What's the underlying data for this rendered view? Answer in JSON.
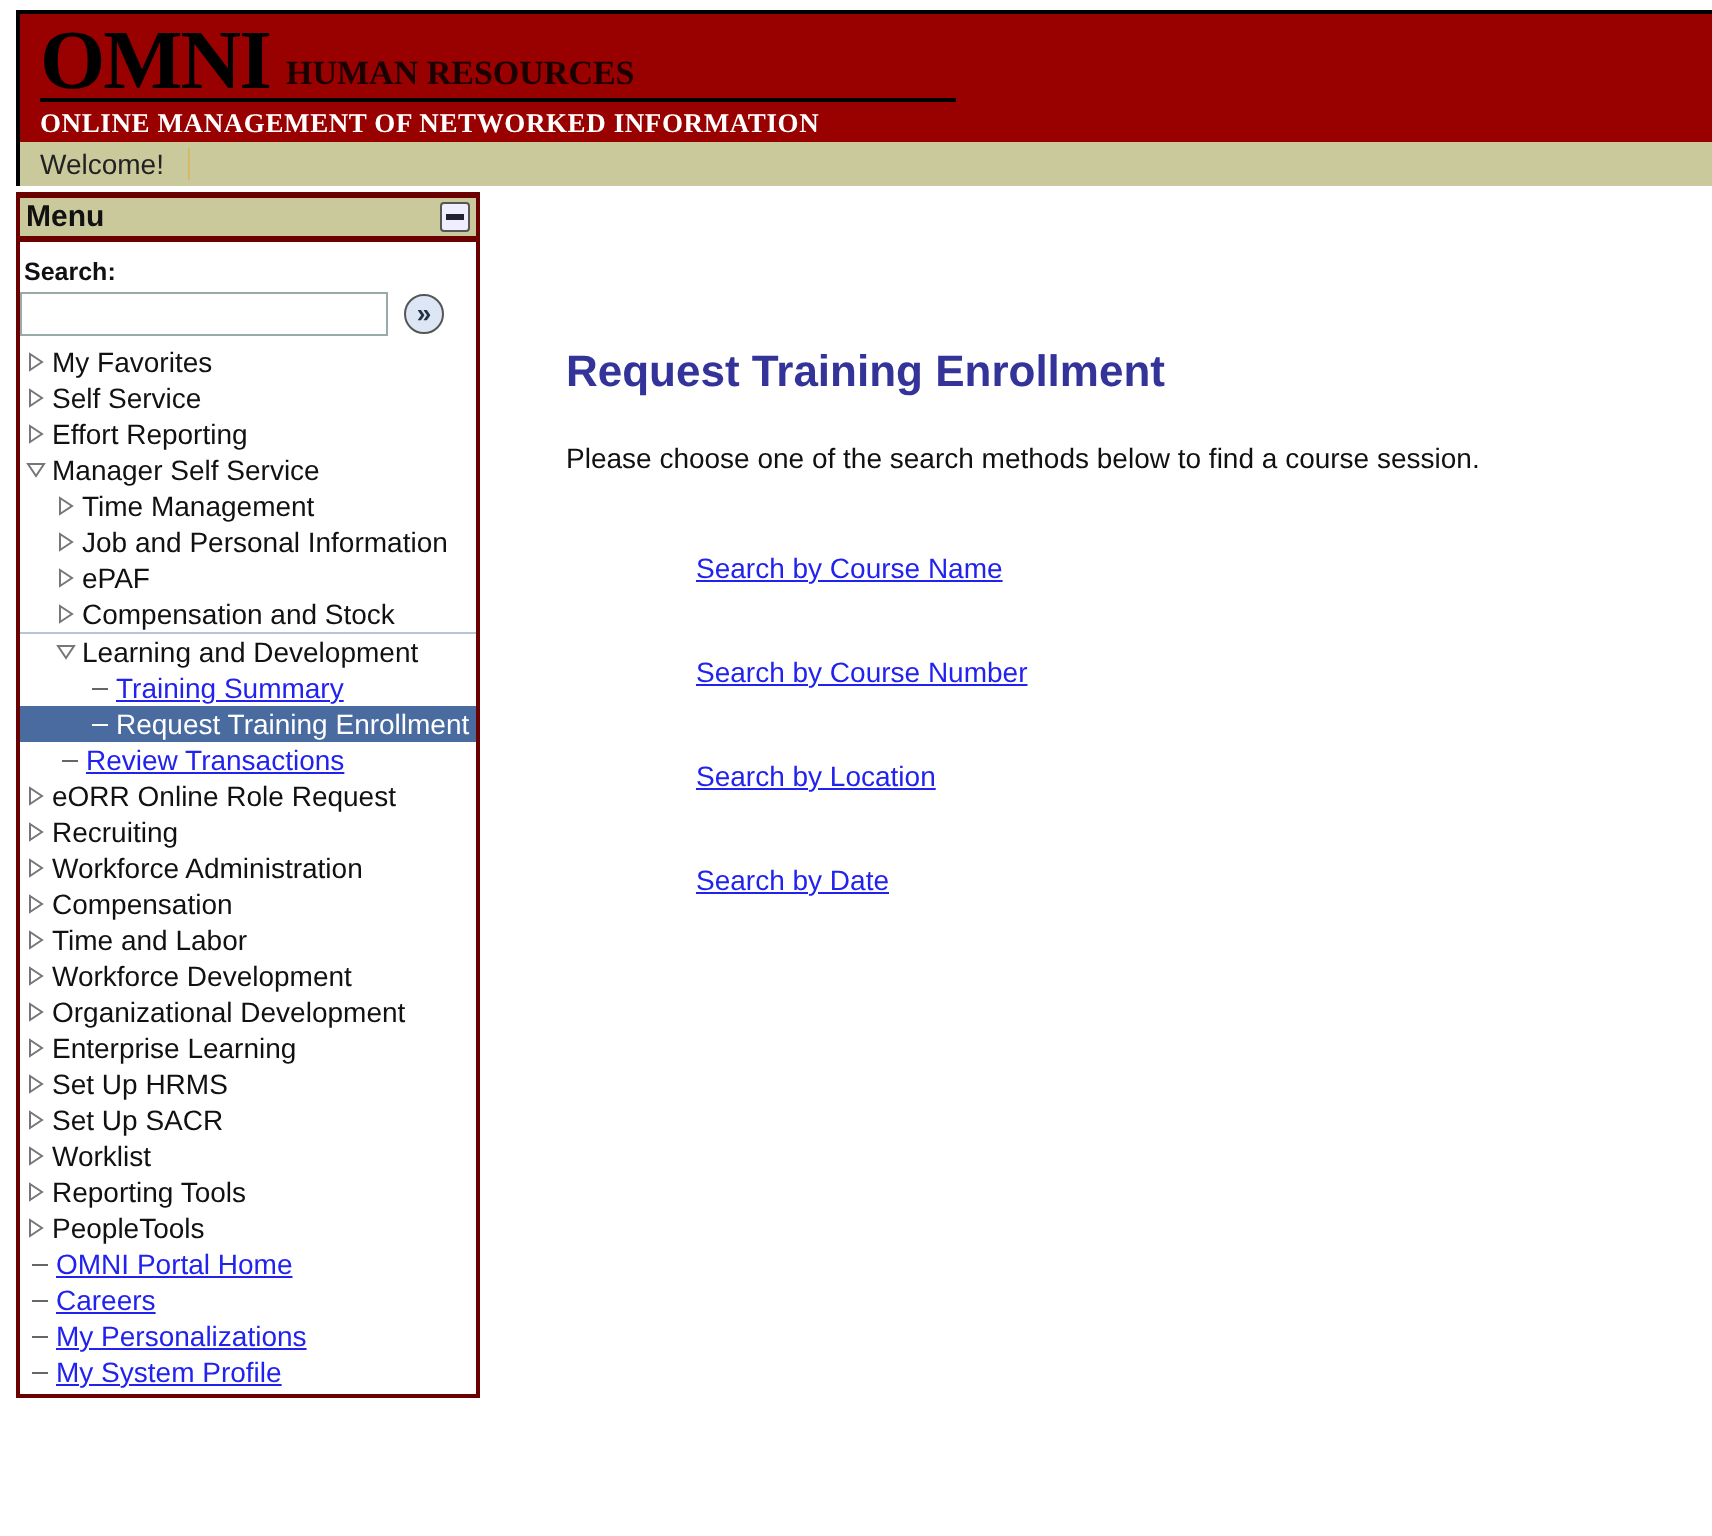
{
  "banner": {
    "logo": "OMNI",
    "product": "HUMAN RESOURCES",
    "tagline": "ONLINE MANAGEMENT OF NETWORKED INFORMATION"
  },
  "welcome": "Welcome!",
  "menu": {
    "title": "Menu",
    "search_label": "Search:",
    "search_button": "»",
    "items": [
      {
        "label": "My Favorites",
        "kind": "folder",
        "expanded": false
      },
      {
        "label": "Self Service",
        "kind": "folder",
        "expanded": false
      },
      {
        "label": "Effort Reporting",
        "kind": "folder",
        "expanded": false
      },
      {
        "label": "Manager Self Service",
        "kind": "folder",
        "expanded": true,
        "children": [
          {
            "label": "Time Management",
            "kind": "folder",
            "expanded": false
          },
          {
            "label": "Job and Personal Information",
            "kind": "folder",
            "expanded": false
          },
          {
            "label": "ePAF",
            "kind": "folder",
            "expanded": false
          },
          {
            "label": "Compensation and Stock",
            "kind": "folder",
            "expanded": false
          },
          {
            "label": "Learning and Development",
            "kind": "folder",
            "expanded": true,
            "children": [
              {
                "label": "Training Summary",
                "kind": "link",
                "selected": false
              },
              {
                "label": "Request Training Enrollment",
                "kind": "link",
                "selected": true
              }
            ]
          }
        ]
      },
      {
        "label": "Review Transactions",
        "kind": "sublink",
        "selected": false
      },
      {
        "label": "eORR Online Role Request",
        "kind": "folder",
        "expanded": false
      },
      {
        "label": "Recruiting",
        "kind": "folder",
        "expanded": false
      },
      {
        "label": "Workforce Administration",
        "kind": "folder",
        "expanded": false
      },
      {
        "label": "Compensation",
        "kind": "folder",
        "expanded": false
      },
      {
        "label": "Time and Labor",
        "kind": "folder",
        "expanded": false
      },
      {
        "label": "Workforce Development",
        "kind": "folder",
        "expanded": false
      },
      {
        "label": "Organizational Development",
        "kind": "folder",
        "expanded": false
      },
      {
        "label": "Enterprise Learning",
        "kind": "folder",
        "expanded": false
      },
      {
        "label": "Set Up HRMS",
        "kind": "folder",
        "expanded": false
      },
      {
        "label": "Set Up SACR",
        "kind": "folder",
        "expanded": false
      },
      {
        "label": "Worklist",
        "kind": "folder",
        "expanded": false
      },
      {
        "label": "Reporting Tools",
        "kind": "folder",
        "expanded": false
      },
      {
        "label": "PeopleTools",
        "kind": "folder",
        "expanded": false
      },
      {
        "label": "OMNI Portal Home",
        "kind": "link",
        "selected": false
      },
      {
        "label": "Careers",
        "kind": "link",
        "selected": false
      },
      {
        "label": "My Personalizations",
        "kind": "link",
        "selected": false
      },
      {
        "label": "My System Profile",
        "kind": "link",
        "selected": false
      }
    ]
  },
  "content": {
    "title": "Request Training Enrollment",
    "instructions": "Please choose one of the search methods below to find a course session.",
    "links": [
      "Search by Course Name",
      "Search by Course Number",
      "Search by Location",
      "Search by Date"
    ]
  }
}
